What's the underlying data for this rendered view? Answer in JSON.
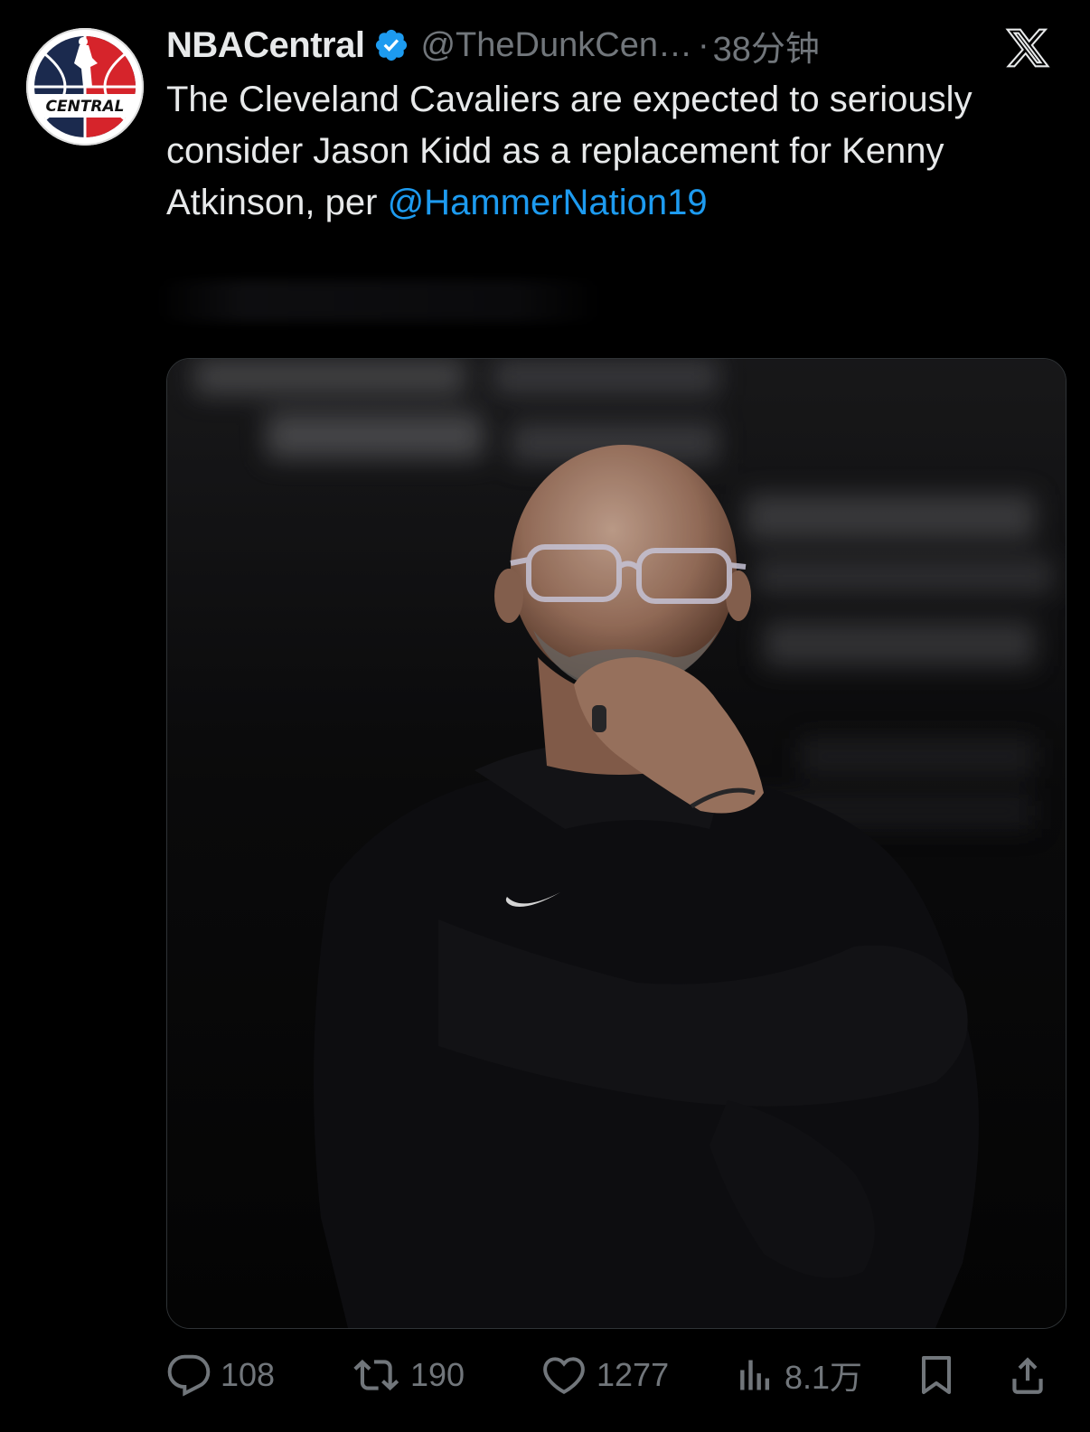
{
  "tweet": {
    "display_name": "NBACentral",
    "handle": "@TheDunkCen…",
    "separator": "·",
    "time": "38分钟",
    "text_before_mention": "The Cleveland Cavaliers are expected to seriously consider Jason Kidd as a replacement for Kenny Atkinson, per ",
    "mention": "@HammerNation19",
    "avatar_text": "CENTRAL"
  },
  "actions": {
    "replies": "108",
    "reposts": "190",
    "likes": "1277",
    "views": "8.1万"
  },
  "colors": {
    "background": "#000000",
    "text": "#e7e9ea",
    "secondary": "#71767b",
    "link": "#1d9bf0",
    "verified": "#1d9bf0",
    "avatar_red": "#d6242b",
    "avatar_navy": "#1b2a4e"
  },
  "icons": {
    "verified": "verified-badge-icon",
    "x_logo": "x-logo-icon",
    "reply": "reply-bubble-icon",
    "repost": "repost-arrows-icon",
    "like": "heart-icon",
    "views": "bar-chart-icon",
    "bookmark": "bookmark-icon",
    "share": "share-upload-icon"
  },
  "media": {
    "description_type": "photo"
  }
}
